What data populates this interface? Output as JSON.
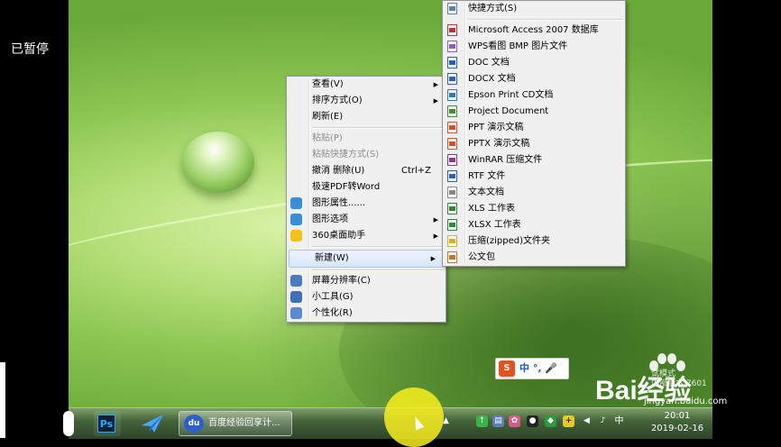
{
  "overlay": {
    "paused_label": "已暂停"
  },
  "context_menu": {
    "items": [
      {
        "label": "查看(V)",
        "submenu": true
      },
      {
        "label": "排序方式(O)",
        "submenu": true
      },
      {
        "label": "刷新(E)"
      },
      {
        "sep": true
      },
      {
        "label": "粘贴(P)",
        "disabled": true
      },
      {
        "label": "粘贴快捷方式(S)",
        "disabled": true
      },
      {
        "label": "撤消 删除(U)",
        "shortcut": "Ctrl+Z"
      },
      {
        "label": "极速PDF转Word"
      },
      {
        "label": "图形属性......",
        "icon": "graphics-icon"
      },
      {
        "label": "图形选项",
        "icon": "graphics-icon",
        "submenu": true
      },
      {
        "label": "360桌面助手",
        "icon": "360-icon",
        "submenu": true
      },
      {
        "sep": true
      },
      {
        "label": "新建(W)",
        "submenu": true,
        "highlighted": true
      },
      {
        "sep": true
      },
      {
        "label": "屏幕分辨率(C)",
        "icon": "monitor-icon"
      },
      {
        "label": "小工具(G)",
        "icon": "gadget-icon"
      },
      {
        "label": "个性化(R)",
        "icon": "personalize-icon"
      }
    ]
  },
  "new_submenu": {
    "items": [
      {
        "label": "快捷方式(S)",
        "icon": "shortcut-icon"
      },
      {
        "sep": true
      },
      {
        "label": "Microsoft Access 2007 数据库",
        "icon": "access-icon"
      },
      {
        "label": "WPS看图 BMP 图片文件",
        "icon": "bmp-icon"
      },
      {
        "label": "DOC 文档",
        "icon": "doc-icon"
      },
      {
        "label": "DOCX 文档",
        "icon": "docx-icon"
      },
      {
        "label": "Epson Print CD文档",
        "icon": "epson-icon"
      },
      {
        "label": "Project Document",
        "icon": "project-icon"
      },
      {
        "label": "PPT 演示文稿",
        "icon": "ppt-icon"
      },
      {
        "label": "PPTX 演示文稿",
        "icon": "pptx-icon"
      },
      {
        "label": "WinRAR 压缩文件",
        "icon": "winrar-icon"
      },
      {
        "label": "RTF 文件",
        "icon": "rtf-icon"
      },
      {
        "label": "文本文档",
        "icon": "txt-icon"
      },
      {
        "label": "XLS 工作表",
        "icon": "xls-icon"
      },
      {
        "label": "XLSX 工作表",
        "icon": "xlsx-icon"
      },
      {
        "label": "压缩(zipped)文件夹",
        "icon": "zip-folder-icon"
      },
      {
        "label": "公文包",
        "icon": "briefcase-icon"
      }
    ]
  },
  "taskbar": {
    "ps_label": "Ps",
    "baidu_icon_label": "du",
    "baidu_window_label": "百度经验回享计...",
    "clock_time": "20:01",
    "clock_date": "2019-02-16"
  },
  "ime": {
    "s_label": "S",
    "text": "中 °, 🎤"
  },
  "watermark": {
    "brand": "Bai经验",
    "url": "jingyan.baidu.com",
    "faint": "试模式\n内部版本 7601"
  },
  "colors": {
    "menu_bg": "#f0f0f0",
    "highlight": "#d8e6fa",
    "desktop_green": "#8cc652"
  }
}
